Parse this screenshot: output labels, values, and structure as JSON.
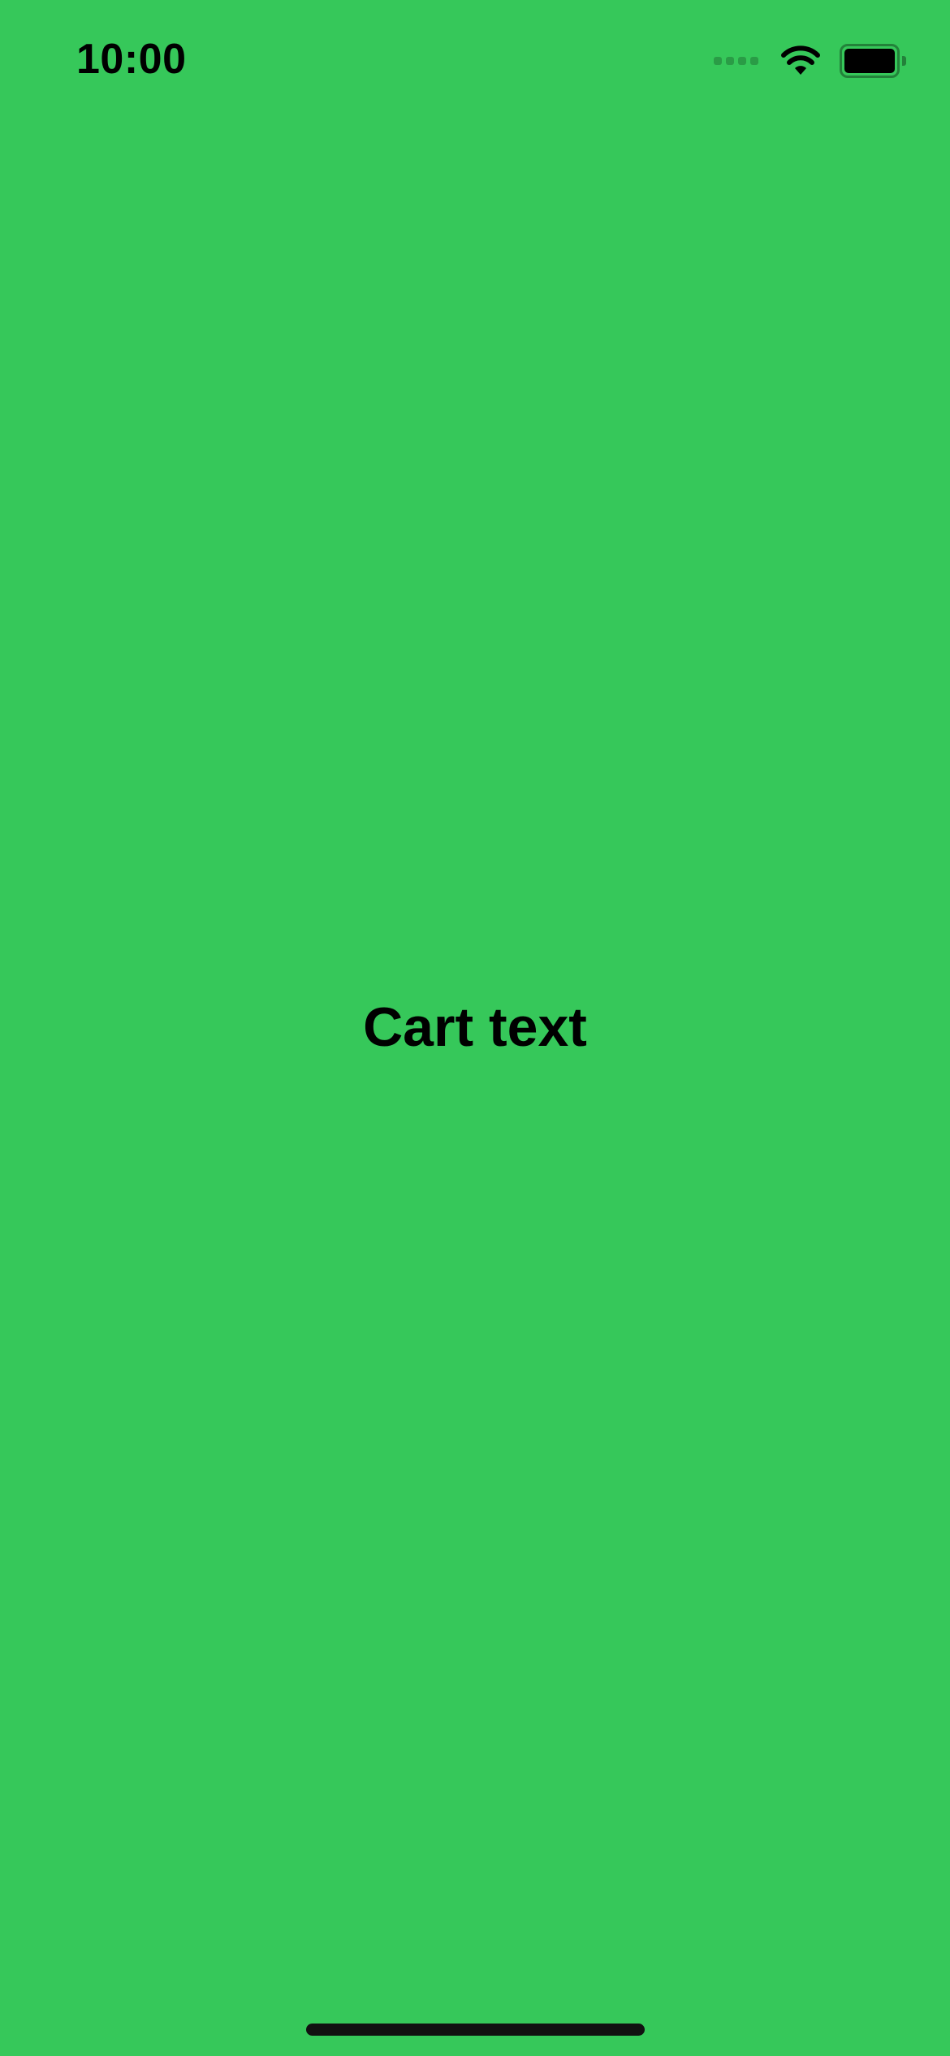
{
  "theme": {
    "background": "#36C85A",
    "text": "#000000"
  },
  "status_bar": {
    "time": "10:00",
    "icons": [
      "cellular-signal-icon",
      "wifi-icon",
      "battery-icon"
    ],
    "battery_level": 1.0
  },
  "main": {
    "title": "Cart text"
  }
}
